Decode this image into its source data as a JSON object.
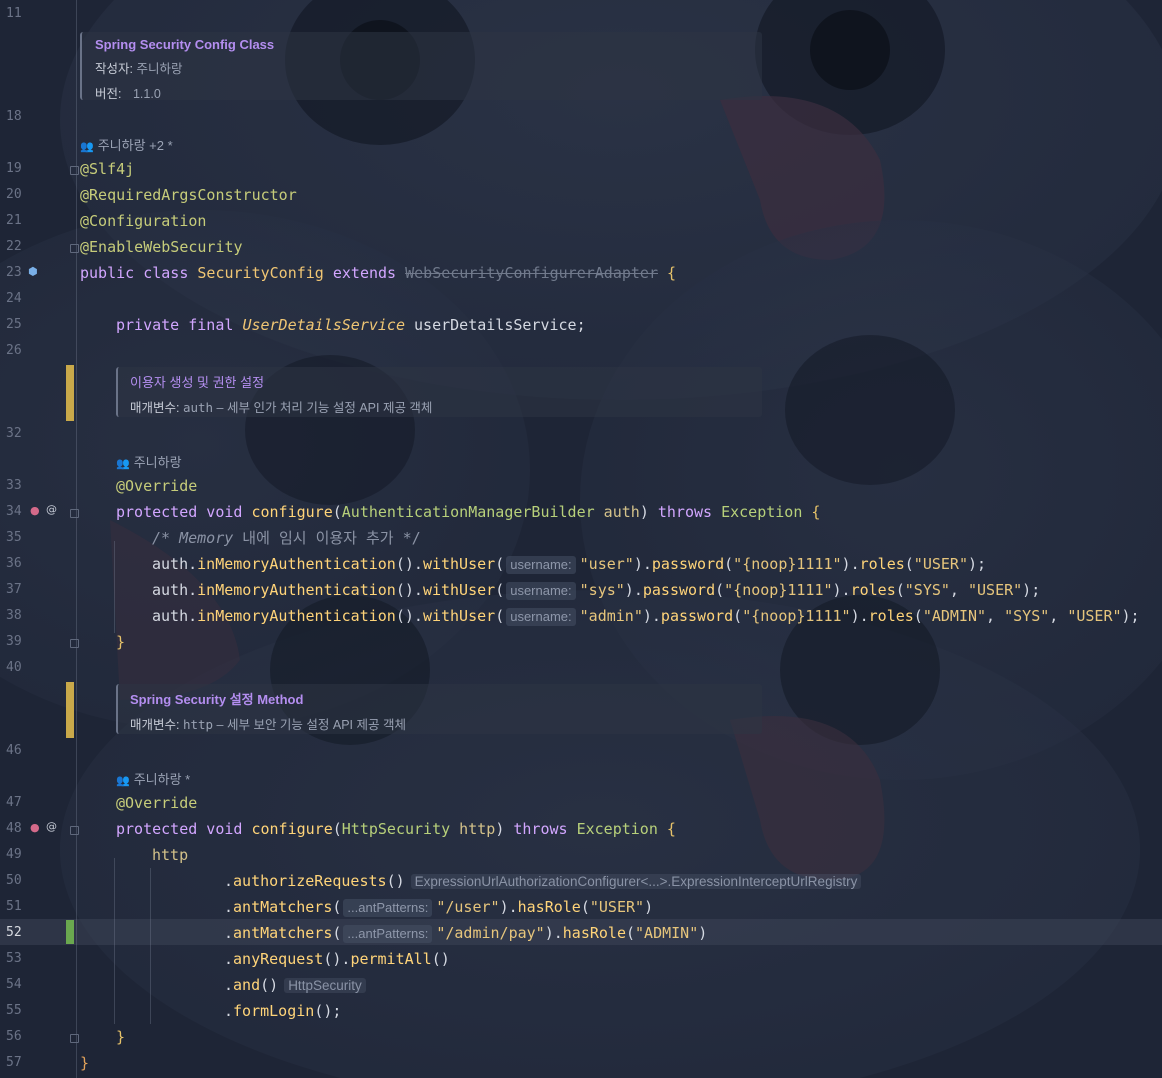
{
  "editor": {
    "current_line": "52",
    "gutter_lines": [
      "11",
      "18",
      "19",
      "20",
      "21",
      "22",
      "23",
      "24",
      "25",
      "26",
      "32",
      "33",
      "34",
      "35",
      "36",
      "37",
      "38",
      "39",
      "40",
      "46",
      "47",
      "48",
      "49",
      "50",
      "51",
      "52",
      "53",
      "54",
      "55",
      "56",
      "57"
    ]
  },
  "docs": {
    "class_doc": {
      "title": "Spring Security Config Class",
      "author_label": "작성자:",
      "author_value": "주니하랑",
      "version_label": "버전:",
      "version_value": "1.1.0"
    },
    "auth_doc": {
      "title": "이용자 생성 및 권한 설정",
      "param_label": "매개변수:",
      "param_name": "auth",
      "param_desc": " – 세부 인가 처리 기능 설정 API 제공 객체"
    },
    "http_doc": {
      "title": "Spring Security 설정 Method",
      "param_label": "매개변수:",
      "param_name": "http",
      "param_desc": " – 세부 보안 기능 설정 API 제공 객체"
    }
  },
  "authors": {
    "class_author": "주니하랑 +2 *",
    "configure_auth_author": "주니하랑",
    "configure_http_author": "주니하랑 *"
  },
  "code": {
    "l19": "@Slf4j",
    "l20": "@RequiredArgsConstructor",
    "l21": "@Configuration",
    "l22": "@EnableWebSecurity",
    "l23_kw": "public class ",
    "l23_cls": "SecurityConfig",
    "l23_ext": " extends ",
    "l23_super": "WebSecurityConfigurerAdapter",
    "l23_brace": " {",
    "l25_kw": "private final ",
    "l25_type": "UserDetailsService",
    "l25_field": " userDetailsService;",
    "override": "@Override",
    "protected_void": "protected void ",
    "configure": "configure",
    "l34_paren": "(",
    "l34_type": "AuthenticationManagerBuilder",
    "l34_param": " auth",
    "l34_close": ") ",
    "throws": "throws",
    "exception": " Exception",
    "open_brace": " {",
    "l35_comment_a": "/* Memory",
    "l35_comment_b": " 내에 임시 이용자 추가 */",
    "auth": "auth",
    "dot": ".",
    "inMemoryAuthentication": "inMemoryAuthentication",
    "paren_pair": "()",
    "withUser": "withUser",
    "open_paren": "(",
    "hint_username": "username:",
    "u1": "\"user\"",
    "u2": "\"sys\"",
    "u3": "\"admin\"",
    "close_paren": ")",
    "password": "password",
    "pw": "\"{noop}1111\"",
    "roles": "roles",
    "r_user": "\"USER\"",
    "r_sys": "\"SYS\"",
    "r_admin": "\"ADMIN\"",
    "comma": ", ",
    "end_stmt": ");",
    "close_brace": "}",
    "l48_type": "HttpSecurity",
    "l48_param": " http",
    "l49": "http",
    "authorizeRequests": "authorizeRequests",
    "hint_registry": "ExpressionUrlAuthorizationConfigurer<...>.ExpressionInterceptUrlRegistry",
    "antMatchers": "antMatchers",
    "hint_ant": "...antPatterns:",
    "p_user": "\"/user\"",
    "p_admin": "\"/admin/pay\"",
    "hasRole": "hasRole",
    "anyRequest": "anyRequest",
    "permitAll": "permitAll",
    "and": "and",
    "hint_http": "HttpSecurity",
    "formLogin": "formLogin",
    "semi_end": "();"
  },
  "icons": {
    "bean": "bean-icon",
    "override_up": "override-icon",
    "at": "at-icon"
  },
  "colors": {
    "background": "#1f2638",
    "annotation": "#c6cc7a",
    "keyword": "#d2a6ff",
    "string": "#e6c57c",
    "vcs_modified": "#c9a94a",
    "vcs_added": "#6aa84f"
  }
}
